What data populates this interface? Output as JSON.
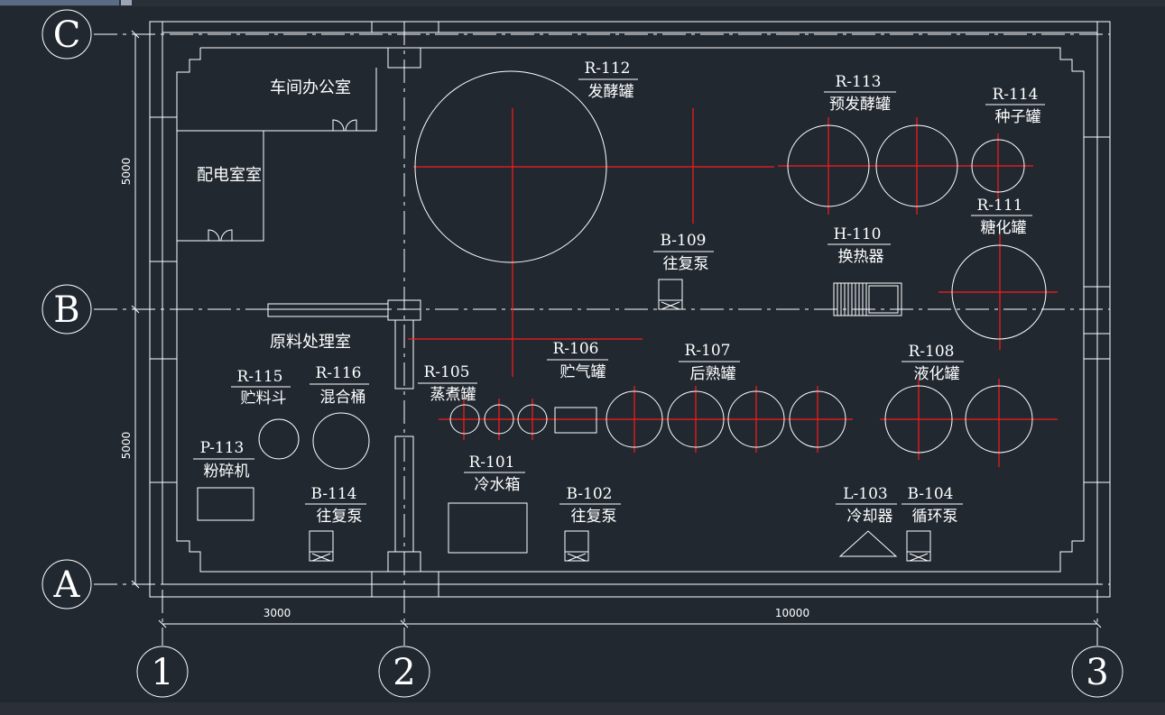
{
  "grid_rows": [
    {
      "id": "axis-c",
      "label": "C"
    },
    {
      "id": "axis-b",
      "label": "B"
    },
    {
      "id": "axis-a",
      "label": "A"
    }
  ],
  "grid_cols": [
    {
      "id": "axis-1",
      "label": "1"
    },
    {
      "id": "axis-2",
      "label": "2"
    },
    {
      "id": "axis-3",
      "label": "3"
    }
  ],
  "dimensions": {
    "left_upper": "5000",
    "left_lower": "5000",
    "bottom_left": "3000",
    "bottom_right": "10000"
  },
  "rooms": {
    "office": "车间办公室",
    "power": "配电室室",
    "raw": "原料处理室"
  },
  "equipment": [
    {
      "code": "R-112",
      "name": "发酵罐"
    },
    {
      "code": "R-113",
      "name": "预发酵罐"
    },
    {
      "code": "R-114",
      "name": "种子罐"
    },
    {
      "code": "R-111",
      "name": "糖化罐"
    },
    {
      "code": "B-109",
      "name": "往复泵"
    },
    {
      "code": "H-110",
      "name": "换热器"
    },
    {
      "code": "R-115",
      "name": "贮料斗"
    },
    {
      "code": "R-116",
      "name": "混合桶"
    },
    {
      "code": "R-105",
      "name": "蒸煮罐"
    },
    {
      "code": "R-106",
      "name": "贮气罐"
    },
    {
      "code": "R-107",
      "name": "后熟罐"
    },
    {
      "code": "R-108",
      "name": "液化罐"
    },
    {
      "code": "P-113",
      "name": "粉碎机"
    },
    {
      "code": "B-114",
      "name": "往复泵"
    },
    {
      "code": "R-101",
      "name": "冷水箱"
    },
    {
      "code": "B-102",
      "name": "往复泵"
    },
    {
      "code": "L-103",
      "name": "冷却器"
    },
    {
      "code": "B-104",
      "name": "循环泵"
    }
  ],
  "colors": {
    "background": "#212830",
    "lines": "#ffffff",
    "centerlines": "#ff1a1a"
  }
}
